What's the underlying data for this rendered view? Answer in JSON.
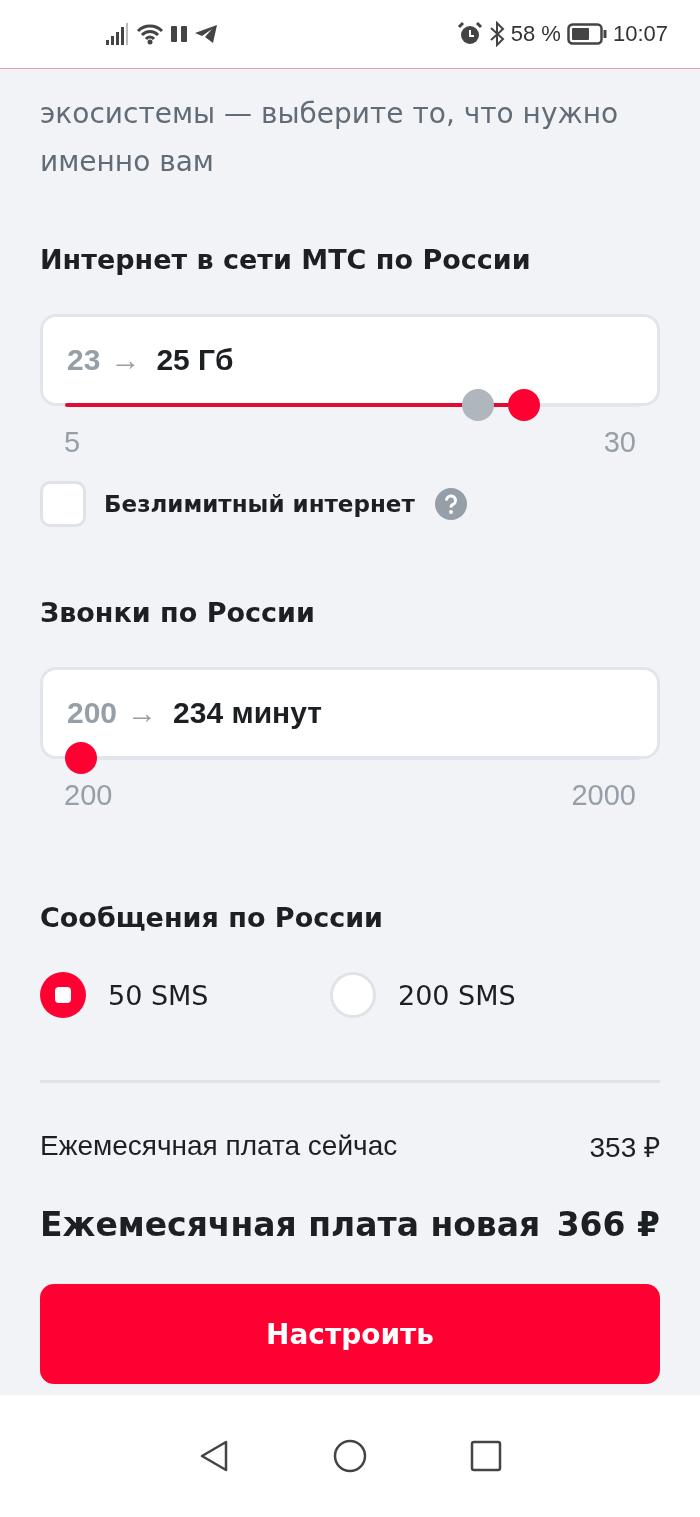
{
  "status_bar": {
    "battery_percent": "58 %",
    "time": "10:07"
  },
  "description": "экосистемы — выберите то, что нужно именно вам",
  "internet": {
    "title": "Интернет в сети МТС по России",
    "from": "23",
    "arrow": "→",
    "to": "25 Гб",
    "level": 0.8,
    "previous": {
      "level": 0.72
    },
    "min": "5",
    "max": "30",
    "unlimited": {
      "label": "Безлимитный интернет",
      "checked": false
    }
  },
  "calls": {
    "title": "Звонки по России",
    "from": "200",
    "arrow": "→",
    "to": "234 минут",
    "level": 0.019,
    "min": "200",
    "max": "2000"
  },
  "sms": {
    "title": "Сообщения по России",
    "options": [
      {
        "label": "50 SMS",
        "selected": true
      },
      {
        "label": "200 SMS",
        "selected": false
      }
    ]
  },
  "prices": [
    {
      "kind": "current",
      "label": "Ежемесячная плата сейчас",
      "value": "353 ₽"
    },
    {
      "kind": "new",
      "label": "Ежемесячная плата новая",
      "value": "366 ₽"
    }
  ],
  "button": "Настроить"
}
